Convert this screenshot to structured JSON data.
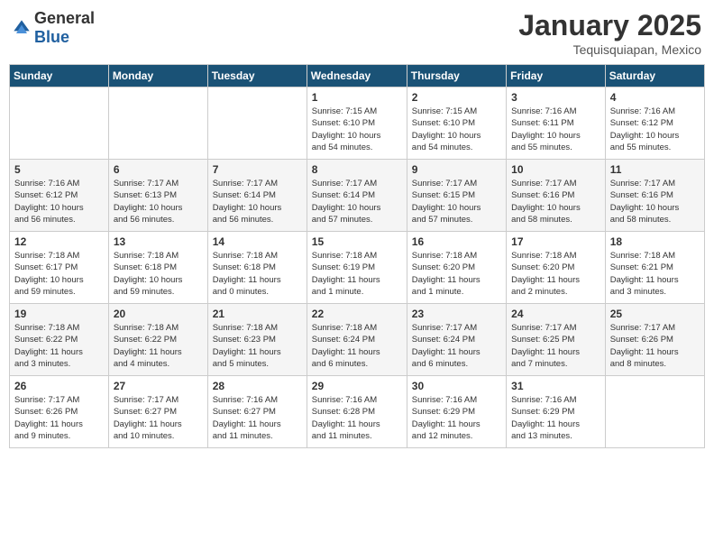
{
  "logo": {
    "general": "General",
    "blue": "Blue"
  },
  "title": "January 2025",
  "location": "Tequisquiapan, Mexico",
  "weekdays": [
    "Sunday",
    "Monday",
    "Tuesday",
    "Wednesday",
    "Thursday",
    "Friday",
    "Saturday"
  ],
  "weeks": [
    [
      {
        "day": "",
        "info": ""
      },
      {
        "day": "",
        "info": ""
      },
      {
        "day": "",
        "info": ""
      },
      {
        "day": "1",
        "info": "Sunrise: 7:15 AM\nSunset: 6:10 PM\nDaylight: 10 hours\nand 54 minutes."
      },
      {
        "day": "2",
        "info": "Sunrise: 7:15 AM\nSunset: 6:10 PM\nDaylight: 10 hours\nand 54 minutes."
      },
      {
        "day": "3",
        "info": "Sunrise: 7:16 AM\nSunset: 6:11 PM\nDaylight: 10 hours\nand 55 minutes."
      },
      {
        "day": "4",
        "info": "Sunrise: 7:16 AM\nSunset: 6:12 PM\nDaylight: 10 hours\nand 55 minutes."
      }
    ],
    [
      {
        "day": "5",
        "info": "Sunrise: 7:16 AM\nSunset: 6:12 PM\nDaylight: 10 hours\nand 56 minutes."
      },
      {
        "day": "6",
        "info": "Sunrise: 7:17 AM\nSunset: 6:13 PM\nDaylight: 10 hours\nand 56 minutes."
      },
      {
        "day": "7",
        "info": "Sunrise: 7:17 AM\nSunset: 6:14 PM\nDaylight: 10 hours\nand 56 minutes."
      },
      {
        "day": "8",
        "info": "Sunrise: 7:17 AM\nSunset: 6:14 PM\nDaylight: 10 hours\nand 57 minutes."
      },
      {
        "day": "9",
        "info": "Sunrise: 7:17 AM\nSunset: 6:15 PM\nDaylight: 10 hours\nand 57 minutes."
      },
      {
        "day": "10",
        "info": "Sunrise: 7:17 AM\nSunset: 6:16 PM\nDaylight: 10 hours\nand 58 minutes."
      },
      {
        "day": "11",
        "info": "Sunrise: 7:17 AM\nSunset: 6:16 PM\nDaylight: 10 hours\nand 58 minutes."
      }
    ],
    [
      {
        "day": "12",
        "info": "Sunrise: 7:18 AM\nSunset: 6:17 PM\nDaylight: 10 hours\nand 59 minutes."
      },
      {
        "day": "13",
        "info": "Sunrise: 7:18 AM\nSunset: 6:18 PM\nDaylight: 10 hours\nand 59 minutes."
      },
      {
        "day": "14",
        "info": "Sunrise: 7:18 AM\nSunset: 6:18 PM\nDaylight: 11 hours\nand 0 minutes."
      },
      {
        "day": "15",
        "info": "Sunrise: 7:18 AM\nSunset: 6:19 PM\nDaylight: 11 hours\nand 1 minute."
      },
      {
        "day": "16",
        "info": "Sunrise: 7:18 AM\nSunset: 6:20 PM\nDaylight: 11 hours\nand 1 minute."
      },
      {
        "day": "17",
        "info": "Sunrise: 7:18 AM\nSunset: 6:20 PM\nDaylight: 11 hours\nand 2 minutes."
      },
      {
        "day": "18",
        "info": "Sunrise: 7:18 AM\nSunset: 6:21 PM\nDaylight: 11 hours\nand 3 minutes."
      }
    ],
    [
      {
        "day": "19",
        "info": "Sunrise: 7:18 AM\nSunset: 6:22 PM\nDaylight: 11 hours\nand 3 minutes."
      },
      {
        "day": "20",
        "info": "Sunrise: 7:18 AM\nSunset: 6:22 PM\nDaylight: 11 hours\nand 4 minutes."
      },
      {
        "day": "21",
        "info": "Sunrise: 7:18 AM\nSunset: 6:23 PM\nDaylight: 11 hours\nand 5 minutes."
      },
      {
        "day": "22",
        "info": "Sunrise: 7:18 AM\nSunset: 6:24 PM\nDaylight: 11 hours\nand 6 minutes."
      },
      {
        "day": "23",
        "info": "Sunrise: 7:17 AM\nSunset: 6:24 PM\nDaylight: 11 hours\nand 6 minutes."
      },
      {
        "day": "24",
        "info": "Sunrise: 7:17 AM\nSunset: 6:25 PM\nDaylight: 11 hours\nand 7 minutes."
      },
      {
        "day": "25",
        "info": "Sunrise: 7:17 AM\nSunset: 6:26 PM\nDaylight: 11 hours\nand 8 minutes."
      }
    ],
    [
      {
        "day": "26",
        "info": "Sunrise: 7:17 AM\nSunset: 6:26 PM\nDaylight: 11 hours\nand 9 minutes."
      },
      {
        "day": "27",
        "info": "Sunrise: 7:17 AM\nSunset: 6:27 PM\nDaylight: 11 hours\nand 10 minutes."
      },
      {
        "day": "28",
        "info": "Sunrise: 7:16 AM\nSunset: 6:27 PM\nDaylight: 11 hours\nand 11 minutes."
      },
      {
        "day": "29",
        "info": "Sunrise: 7:16 AM\nSunset: 6:28 PM\nDaylight: 11 hours\nand 11 minutes."
      },
      {
        "day": "30",
        "info": "Sunrise: 7:16 AM\nSunset: 6:29 PM\nDaylight: 11 hours\nand 12 minutes."
      },
      {
        "day": "31",
        "info": "Sunrise: 7:16 AM\nSunset: 6:29 PM\nDaylight: 11 hours\nand 13 minutes."
      },
      {
        "day": "",
        "info": ""
      }
    ]
  ]
}
